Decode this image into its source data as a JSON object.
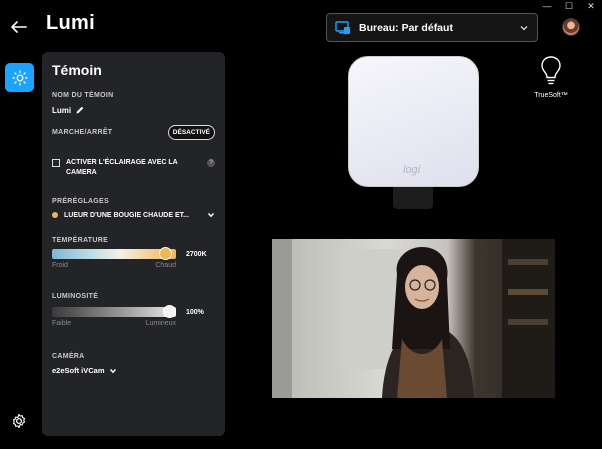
{
  "window": {
    "controls": [
      "—",
      "☐",
      "✕"
    ]
  },
  "header": {
    "title": "Lumi",
    "profile_label": "Bureau: Par défaut"
  },
  "colors": {
    "accent": "#1aa3ff",
    "panel_bg": "#232427",
    "preset_dot": "#e9b860"
  },
  "panel": {
    "title": "Témoin",
    "name_label": "NOM DU TÉMOIN",
    "name_value": "Lumi",
    "power_label": "MARCHE/ARRÊT",
    "power_state": "DÉSACTIVÉ",
    "camera_light_label": "ACTIVER L'ÉCLAIRAGE AVEC LA CAMERA",
    "camera_light_checked": false,
    "presets_label": "PRÉRÉGLAGES",
    "preset_value": "LUEUR D'UNE BOUGIE CHAUDE ET...",
    "temperature": {
      "label": "TEMPÉRATURE",
      "value_text": "2700K",
      "position": 0.96,
      "min_label": "Froid",
      "max_label": "Chaud"
    },
    "brightness": {
      "label": "LUMINOSITÉ",
      "value_text": "100%",
      "position": 1.0,
      "min_label": "Faible",
      "max_label": "Lumineux"
    },
    "camera_label": "CAMÉRA",
    "camera_value": "e2eSoft iVCam"
  },
  "device": {
    "logo": "logi",
    "feature_label": "TrueSoft™"
  },
  "icons": {
    "back": "arrow-left-icon",
    "profile": "desktop-icon",
    "rail_active": "sun-icon",
    "settings": "gear-icon",
    "feature": "bulb-icon"
  }
}
